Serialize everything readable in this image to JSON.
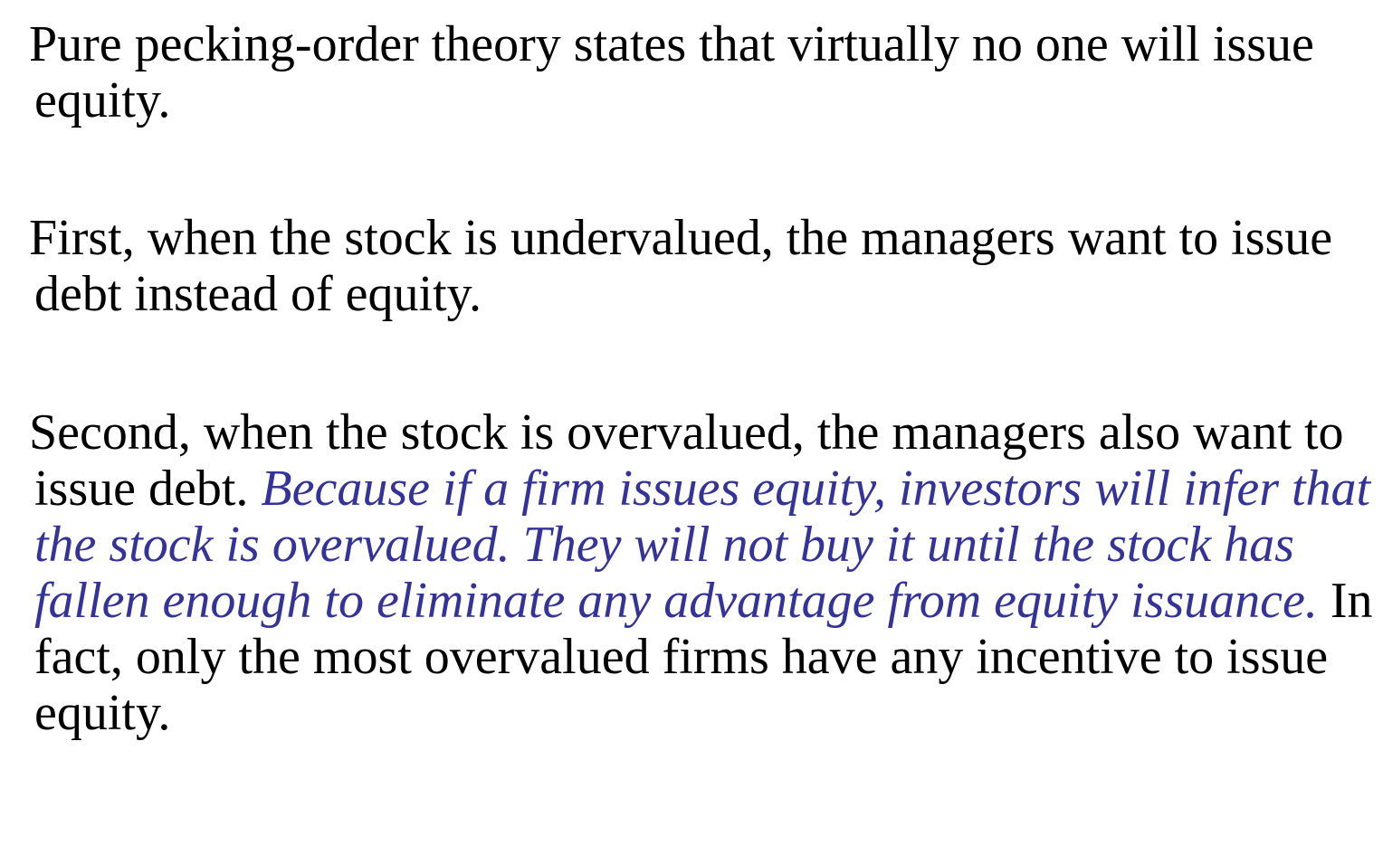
{
  "paragraphs": {
    "p1": {
      "text": "Pure pecking-order theory states that virtually no one will issue equity."
    },
    "p2": {
      "text": "First, when the stock is undervalued, the managers want to issue debt instead of equity."
    },
    "p3": {
      "lead": "Second, when the stock is overvalued, the managers also want to issue debt.",
      "emphasis": "Because if a firm issues equity, investors will infer that the stock is overvalued. They will not buy it until the stock has fallen enough to eliminate any advantage from equity issuance.",
      "tail": "In fact, only the most overvalued firms have any incentive to issue equity."
    }
  },
  "colors": {
    "body_text": "#000000",
    "emphasis_text": "#333399",
    "background": "#ffffff"
  }
}
